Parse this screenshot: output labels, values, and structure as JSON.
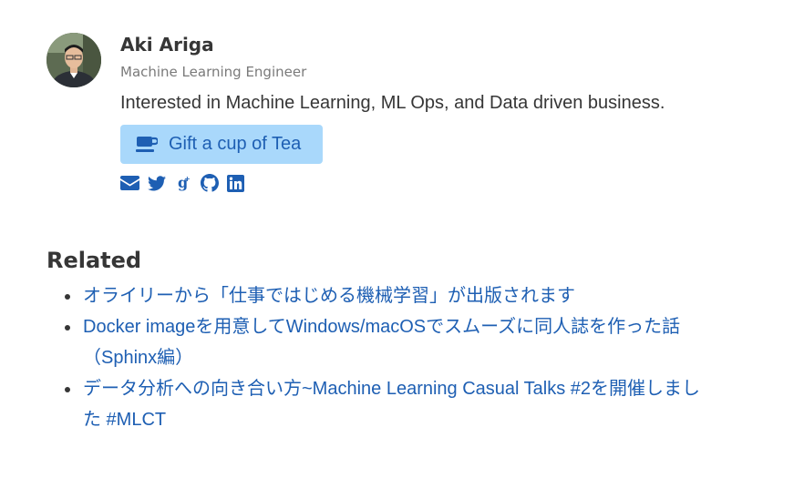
{
  "author": {
    "name": "Aki Ariga",
    "title": "Machine Learning Engineer",
    "bio": "Interested in Machine Learning, ML Ops, and Data driven business.",
    "gift_button_label": "Gift a cup of Tea",
    "social_icons": [
      "envelope-icon",
      "twitter-icon",
      "google-plus-icon",
      "github-icon",
      "linkedin-icon"
    ]
  },
  "related": {
    "heading": "Related",
    "items": [
      {
        "label": "オライリーから「仕事ではじめる機械学習」が出版されます"
      },
      {
        "label": "Docker imageを用意してWindows/macOSでスムーズに同人誌を作った話（Sphinx編）"
      },
      {
        "label": "データ分析への向き合い方~Machine Learning Casual Talks #2を開催しました #MLCT"
      }
    ]
  },
  "colors": {
    "link": "#1e5fb3",
    "button_bg": "#a9d8fb",
    "text": "#363636",
    "muted": "#7a7a7a"
  }
}
